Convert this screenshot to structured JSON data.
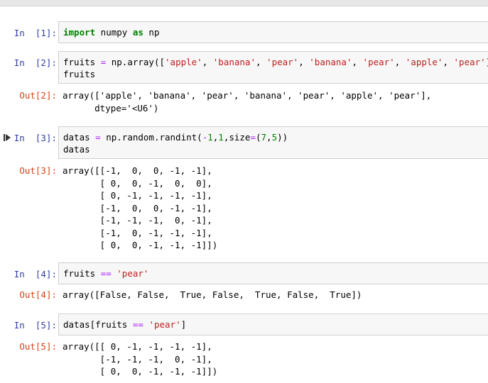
{
  "cells": [
    {
      "in_prompt": "In  [1]:",
      "code_lines": [
        [
          {
            "t": "import",
            "c": "kw"
          },
          {
            "t": " numpy ",
            "c": ""
          },
          {
            "t": "as",
            "c": "kw"
          },
          {
            "t": " np",
            "c": ""
          }
        ]
      ]
    },
    {
      "in_prompt": "In  [2]:",
      "code_lines": [
        [
          {
            "t": "fruits ",
            "c": ""
          },
          {
            "t": "=",
            "c": "op"
          },
          {
            "t": " np.array([",
            "c": ""
          },
          {
            "t": "'apple'",
            "c": "str"
          },
          {
            "t": ", ",
            "c": ""
          },
          {
            "t": "'banana'",
            "c": "str"
          },
          {
            "t": ", ",
            "c": ""
          },
          {
            "t": "'pear'",
            "c": "str"
          },
          {
            "t": ", ",
            "c": ""
          },
          {
            "t": "'banana'",
            "c": "str"
          },
          {
            "t": ", ",
            "c": ""
          },
          {
            "t": "'pear'",
            "c": "str"
          },
          {
            "t": ", ",
            "c": ""
          },
          {
            "t": "'apple'",
            "c": "str"
          },
          {
            "t": ", ",
            "c": ""
          },
          {
            "t": "'pear'",
            "c": "str"
          },
          {
            "t": "])",
            "c": ""
          }
        ],
        [
          {
            "t": "fruits",
            "c": ""
          }
        ]
      ],
      "out_prompt": "Out[2]:",
      "output": "array(['apple', 'banana', 'pear', 'banana', 'pear', 'apple', 'pear'],\n      dtype='<U6')"
    },
    {
      "in_prompt": "In  [3]:",
      "code_lines": [
        [
          {
            "t": "datas ",
            "c": ""
          },
          {
            "t": "=",
            "c": "op"
          },
          {
            "t": " np.random.randint(",
            "c": ""
          },
          {
            "t": "-",
            "c": "op"
          },
          {
            "t": "1",
            "c": "num"
          },
          {
            "t": ",",
            "c": ""
          },
          {
            "t": "1",
            "c": "num"
          },
          {
            "t": ",size",
            "c": ""
          },
          {
            "t": "=",
            "c": "op"
          },
          {
            "t": "(",
            "c": ""
          },
          {
            "t": "7",
            "c": "num"
          },
          {
            "t": ",",
            "c": ""
          },
          {
            "t": "5",
            "c": "num"
          },
          {
            "t": "))",
            "c": ""
          }
        ],
        [
          {
            "t": "datas",
            "c": ""
          }
        ]
      ],
      "out_prompt": "Out[3]:",
      "output": "array([[-1,  0,  0, -1, -1],\n       [ 0,  0, -1,  0,  0],\n       [ 0, -1, -1, -1, -1],\n       [-1,  0,  0, -1, -1],\n       [-1, -1, -1,  0, -1],\n       [-1,  0, -1, -1, -1],\n       [ 0,  0, -1, -1, -1]])"
    },
    {
      "in_prompt": "In  [4]:",
      "code_lines": [
        [
          {
            "t": "fruits ",
            "c": ""
          },
          {
            "t": "==",
            "c": "op"
          },
          {
            "t": " ",
            "c": ""
          },
          {
            "t": "'pear'",
            "c": "str"
          }
        ]
      ],
      "out_prompt": "Out[4]:",
      "output": "array([False, False,  True, False,  True, False,  True])"
    },
    {
      "in_prompt": "In  [5]:",
      "code_lines": [
        [
          {
            "t": "datas[fruits ",
            "c": ""
          },
          {
            "t": "==",
            "c": "op"
          },
          {
            "t": " ",
            "c": ""
          },
          {
            "t": "'pear'",
            "c": "str"
          },
          {
            "t": "]",
            "c": ""
          }
        ]
      ],
      "out_prompt": "Out[5]:",
      "output": "array([[ 0, -1, -1, -1, -1],\n       [-1, -1, -1,  0, -1],\n       [ 0,  0, -1, -1, -1]])"
    }
  ],
  "icons": {
    "run_indicator": "run-arrow-icon"
  },
  "colors": {
    "in_prompt": "#303f9f",
    "out_prompt": "#d84315",
    "keyword": "#008000",
    "string": "#ba2121",
    "operator": "#aa22ff"
  }
}
